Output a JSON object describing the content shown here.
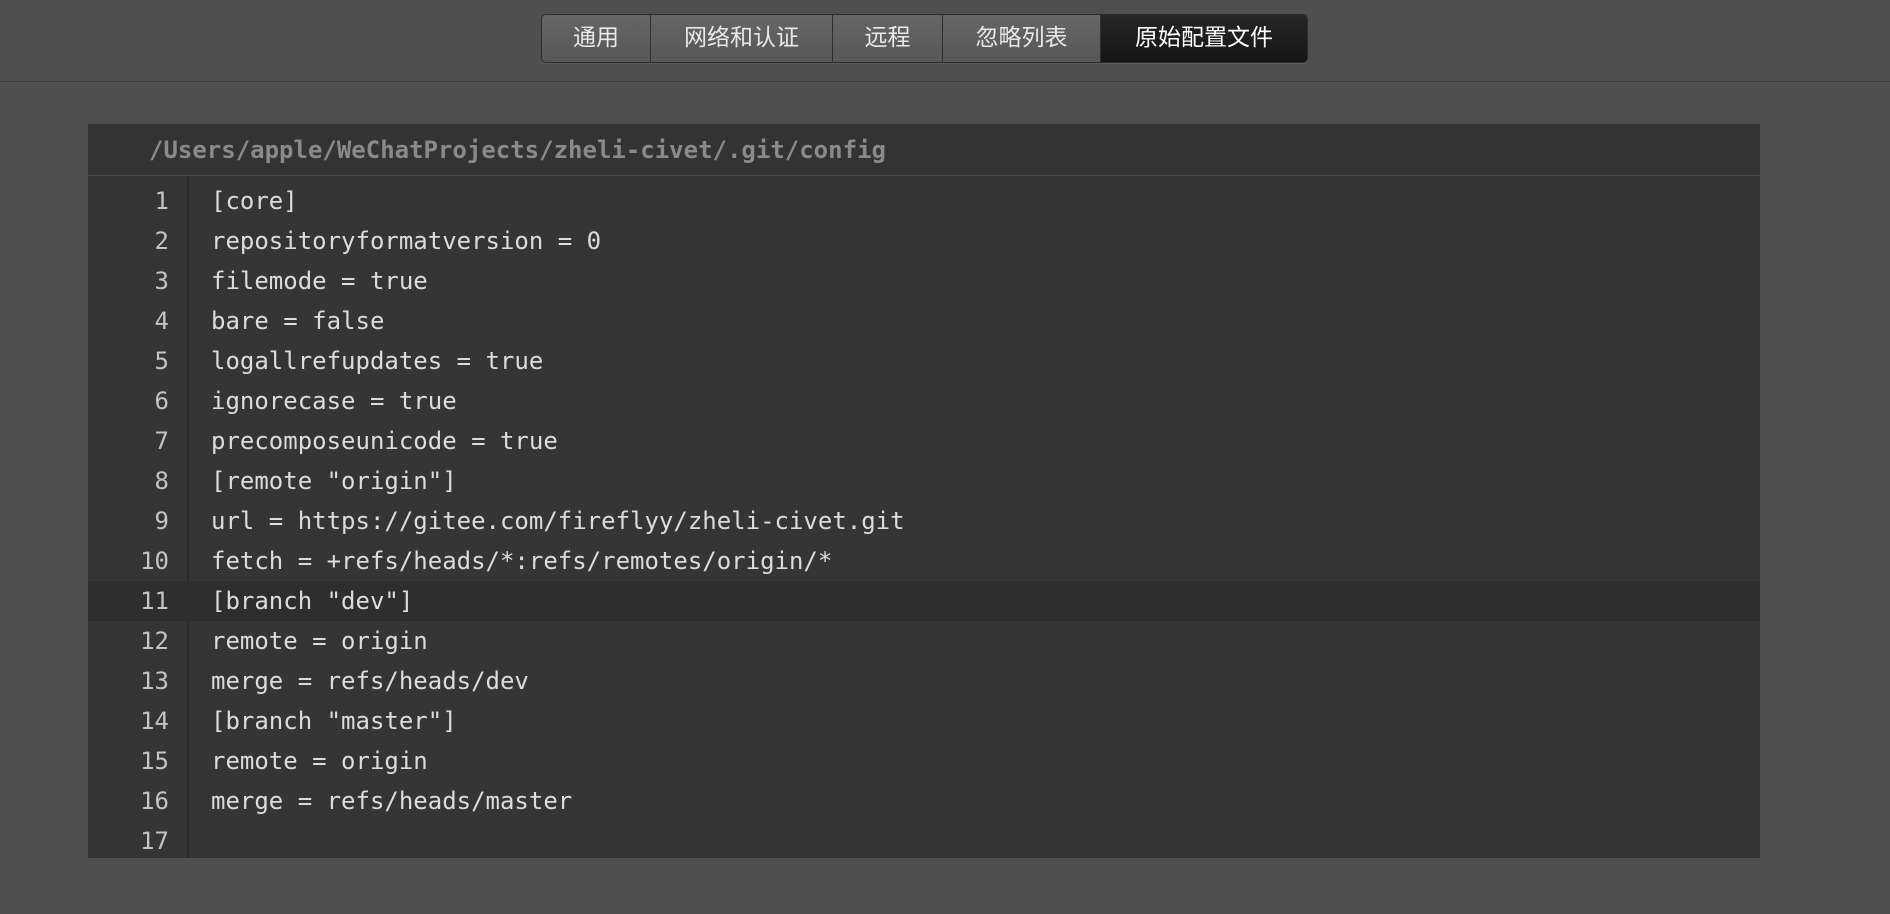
{
  "tabs": [
    {
      "label": "通用",
      "active": false
    },
    {
      "label": "网络和认证",
      "active": false
    },
    {
      "label": "远程",
      "active": false
    },
    {
      "label": "忽略列表",
      "active": false
    },
    {
      "label": "原始配置文件",
      "active": true
    }
  ],
  "editor": {
    "file_path": "/Users/apple/WeChatProjects/zheli-civet/.git/config",
    "current_line": 11,
    "lines": [
      {
        "number": "1",
        "text": "[core]"
      },
      {
        "number": "2",
        "text": "repositoryformatversion = 0"
      },
      {
        "number": "3",
        "text": "filemode = true"
      },
      {
        "number": "4",
        "text": "bare = false"
      },
      {
        "number": "5",
        "text": "logallrefupdates = true"
      },
      {
        "number": "6",
        "text": "ignorecase = true"
      },
      {
        "number": "7",
        "text": "precomposeunicode = true"
      },
      {
        "number": "8",
        "text": "[remote \"origin\"]"
      },
      {
        "number": "9",
        "text": "url = https://gitee.com/fireflyy/zheli-civet.git"
      },
      {
        "number": "10",
        "text": "fetch = +refs/heads/*:refs/remotes/origin/*"
      },
      {
        "number": "11",
        "text": "[branch \"dev\"]"
      },
      {
        "number": "12",
        "text": "remote = origin"
      },
      {
        "number": "13",
        "text": "merge = refs/heads/dev"
      },
      {
        "number": "14",
        "text": "[branch \"master\"]"
      },
      {
        "number": "15",
        "text": "remote = origin"
      },
      {
        "number": "16",
        "text": "merge = refs/heads/master"
      },
      {
        "number": "17",
        "text": ""
      }
    ]
  }
}
